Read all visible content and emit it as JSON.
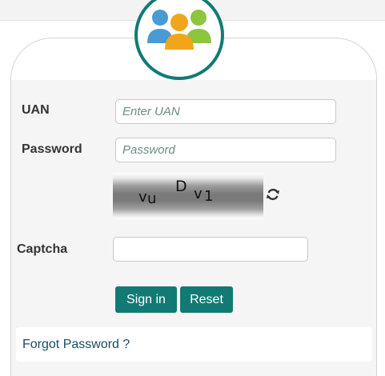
{
  "form": {
    "uan_label": "UAN",
    "uan_placeholder": "Enter UAN",
    "uan_value": "",
    "password_label": "Password",
    "password_placeholder": "Password",
    "password_value": "",
    "captcha_label": "Captcha",
    "captcha_value": "",
    "captcha_text": [
      "v",
      "u",
      "D",
      "v",
      "1"
    ],
    "signin_label": "Sign in",
    "reset_label": "Reset",
    "forgot_label": "Forgot Password ?"
  },
  "icons": {
    "logo": "users-group-icon",
    "refresh": "refresh-icon"
  },
  "colors": {
    "accent": "#127a74",
    "link": "#1a4a66",
    "logo_blue": "#4a9ad4",
    "logo_orange": "#f2a51a",
    "logo_green": "#8cc63f"
  }
}
